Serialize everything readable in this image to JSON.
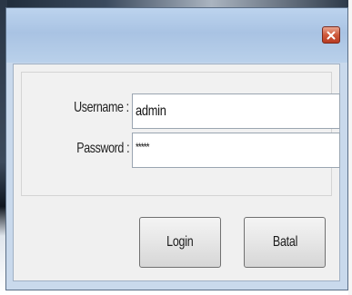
{
  "dialog": {
    "title": "",
    "close_icon": "close-icon",
    "close_color": "#cf5a3c"
  },
  "form": {
    "username_label": "Username :",
    "username_value": "admin",
    "password_label": "Password :",
    "password_value": "*****"
  },
  "buttons": {
    "login_label": "Login",
    "cancel_label": "Batal"
  },
  "colors": {
    "title_bar": "#b9d0ea",
    "client_bg": "#f0f0f0"
  }
}
